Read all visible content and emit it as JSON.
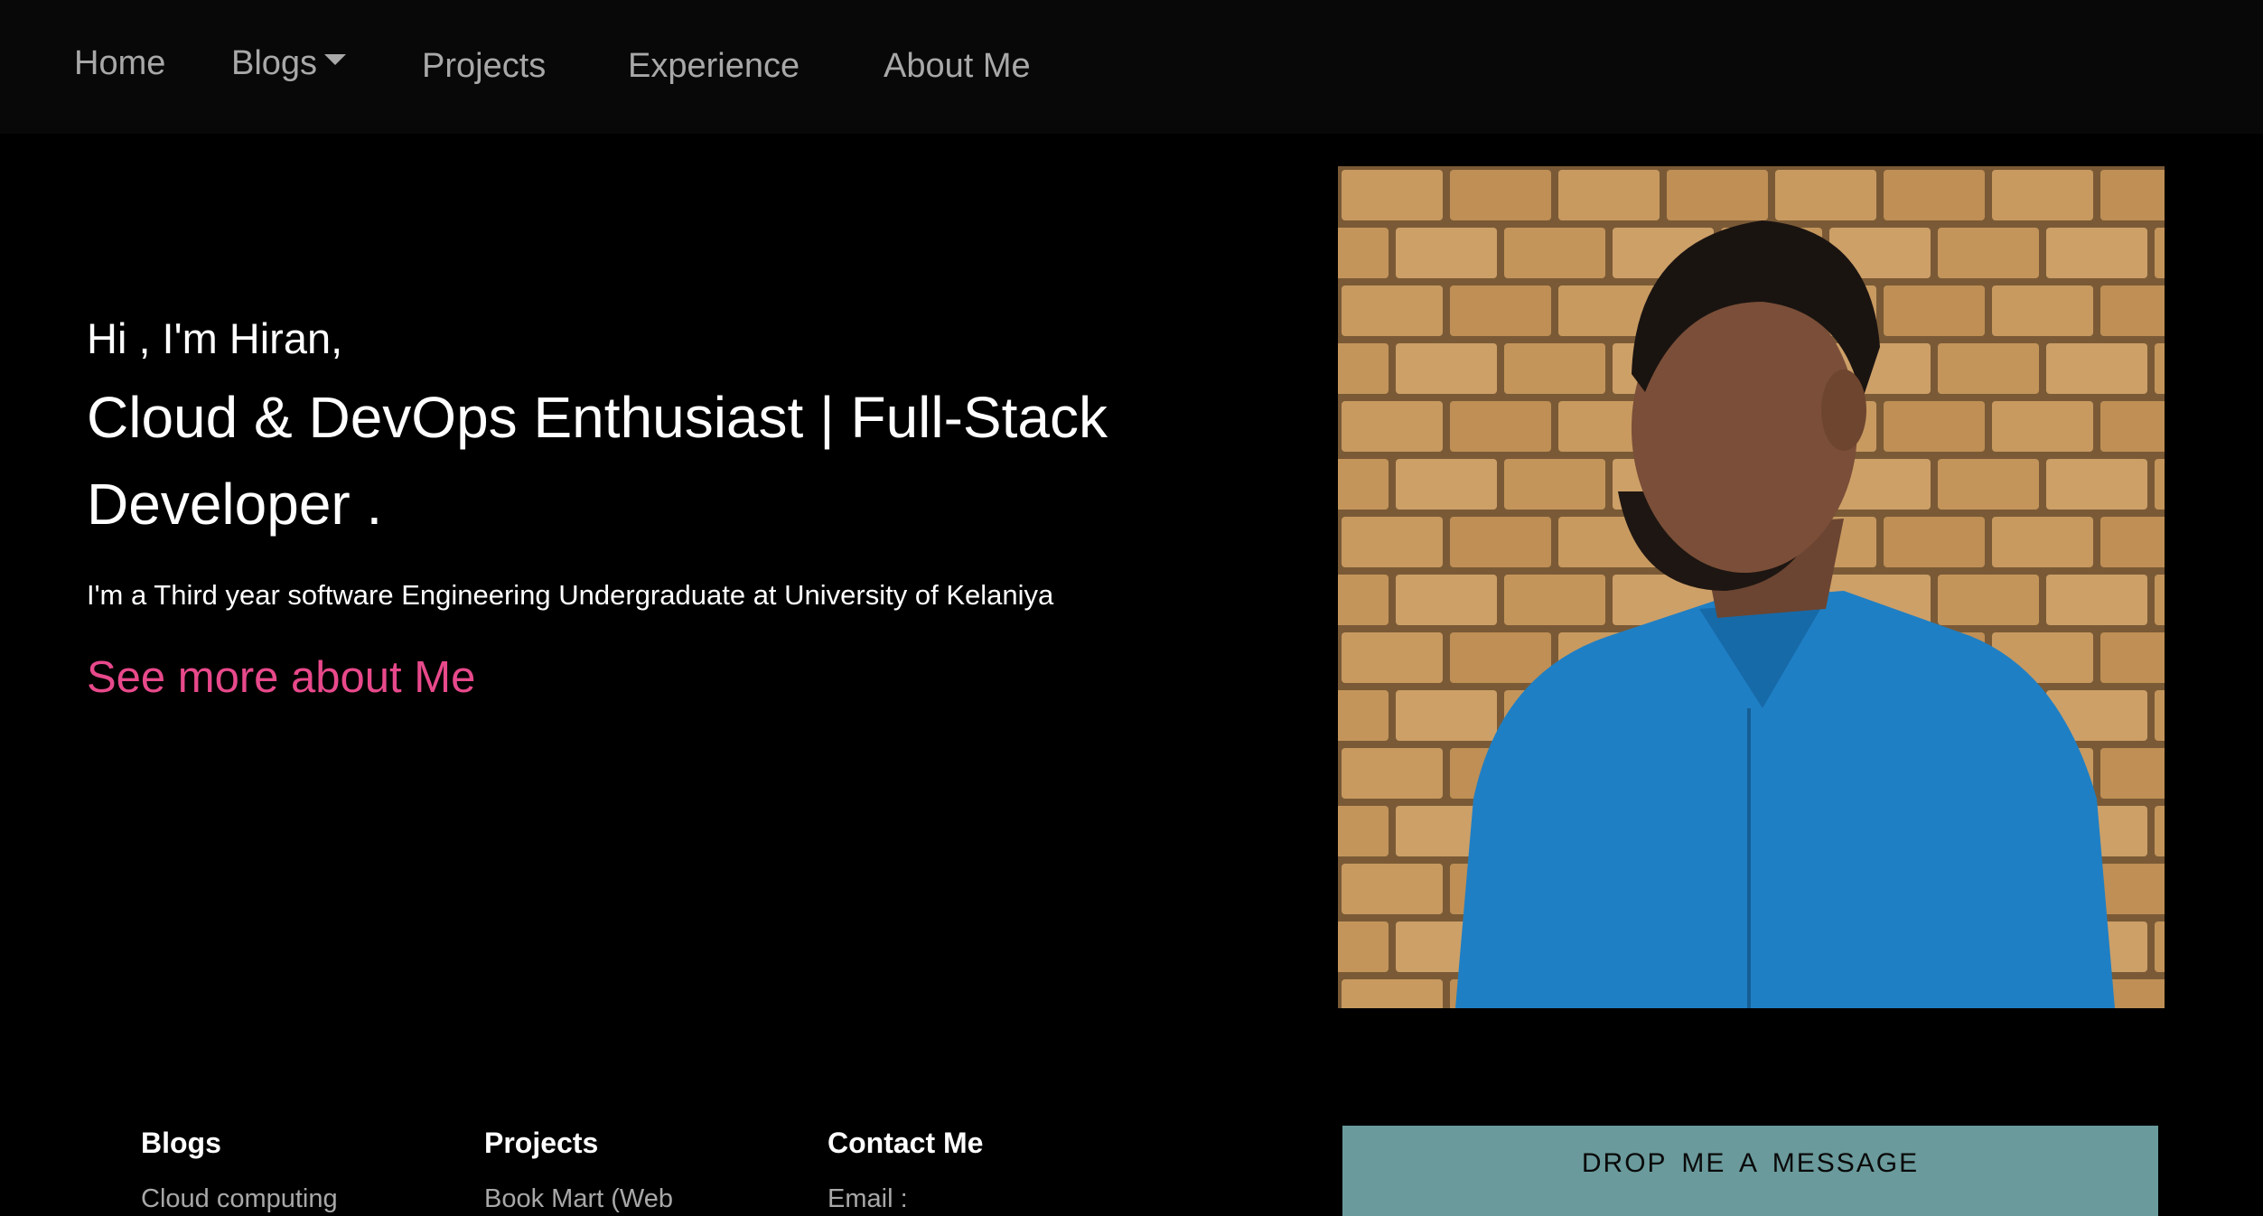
{
  "nav": {
    "home": "Home",
    "blogs": "Blogs",
    "projects": "Projects",
    "experience": "Experience",
    "about": "About Me"
  },
  "hero": {
    "greeting": "Hi , I'm Hiran,",
    "title": "Cloud & DevOps Enthusiast | Full-Stack Developer .",
    "subtitle": "I'm a Third year software Engineering Undergraduate at University of Kelaniya",
    "cta": "See more about Me"
  },
  "footer": {
    "blogs_heading": "Blogs",
    "projects_heading": "Projects",
    "contact_heading": "Contact Me",
    "blog_item": "Cloud computing",
    "project_item": "Book Mart (Web",
    "email_label": "Email :",
    "message_panel_title": "DROP ME A MESSAGE"
  },
  "colors": {
    "background": "#000000",
    "navbar": "#080808",
    "nav_text": "#a8a8a8",
    "accent_link": "#e8498b",
    "message_panel": "#6a9a9c"
  }
}
